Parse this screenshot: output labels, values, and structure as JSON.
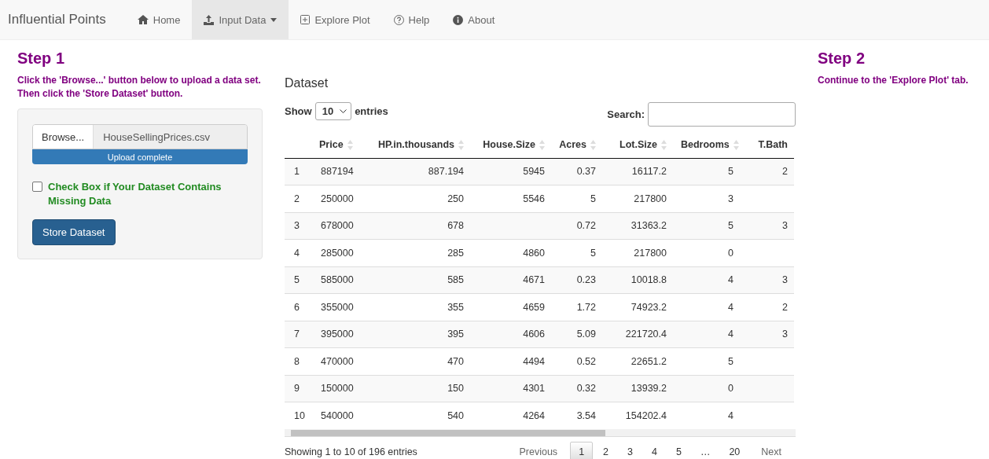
{
  "navbar": {
    "brand": "Influential Points",
    "items": [
      {
        "label": "Home",
        "selected": false,
        "dropdown": false
      },
      {
        "label": "Input Data",
        "selected": true,
        "dropdown": true
      },
      {
        "label": "Explore Plot",
        "selected": false,
        "dropdown": false
      },
      {
        "label": "Help",
        "selected": false,
        "dropdown": false
      },
      {
        "label": "About",
        "selected": false,
        "dropdown": false
      }
    ]
  },
  "step1": {
    "title": "Step 1",
    "instructions": "Click the 'Browse...' button below to upload a data set. Then click the 'Store Dataset' button.",
    "file_input": {
      "button": "Browse...",
      "value": "HouseSellingPrices.csv"
    },
    "progress": {
      "label": "Upload complete",
      "level": 1
    },
    "checkbox": {
      "label": "Check Box if Your Dataset Contains Missing Data",
      "checked": false
    },
    "store_button": "Store Dataset"
  },
  "dataset": {
    "title": "Dataset",
    "length_label_before": "Show",
    "length_value": "10",
    "length_label_after": "entries",
    "search_label": "Search:",
    "columns": [
      {
        "label": "Price",
        "sortable": true
      },
      {
        "label": "HP.in.thousands",
        "sortable": true
      },
      {
        "label": "House.Size",
        "sortable": true
      },
      {
        "label": "Acres",
        "sortable": true
      },
      {
        "label": "Lot.Size",
        "sortable": true
      },
      {
        "label": "Bedrooms",
        "sortable": true
      },
      {
        "label": "T.Bath",
        "sortable": false
      }
    ],
    "rows": [
      {
        "index": "1",
        "cells": [
          "887194",
          "887.194",
          "5945",
          "0.37",
          "16117.2",
          "5",
          "2"
        ]
      },
      {
        "index": "2",
        "cells": [
          "250000",
          "250",
          "5546",
          "5",
          "217800",
          "3",
          ""
        ]
      },
      {
        "index": "3",
        "cells": [
          "678000",
          "678",
          "",
          "0.72",
          "31363.2",
          "5",
          "3"
        ]
      },
      {
        "index": "4",
        "cells": [
          "285000",
          "285",
          "4860",
          "5",
          "217800",
          "0",
          ""
        ]
      },
      {
        "index": "5",
        "cells": [
          "585000",
          "585",
          "4671",
          "0.23",
          "10018.8",
          "4",
          "3"
        ]
      },
      {
        "index": "6",
        "cells": [
          "355000",
          "355",
          "4659",
          "1.72",
          "74923.2",
          "4",
          "2"
        ]
      },
      {
        "index": "7",
        "cells": [
          "395000",
          "395",
          "4606",
          "5.09",
          "221720.4",
          "4",
          "3"
        ]
      },
      {
        "index": "8",
        "cells": [
          "470000",
          "470",
          "4494",
          "0.52",
          "22651.2",
          "5",
          ""
        ]
      },
      {
        "index": "9",
        "cells": [
          "150000",
          "150",
          "4301",
          "0.32",
          "13939.2",
          "0",
          ""
        ]
      },
      {
        "index": "10",
        "cells": [
          "540000",
          "540",
          "4264",
          "3.54",
          "154202.4",
          "4",
          ""
        ]
      }
    ],
    "info": "Showing 1 to 10 of 196 entries",
    "pagination": [
      {
        "label": "Previous",
        "kind": "nav",
        "selected": false
      },
      {
        "label": "1",
        "kind": "page",
        "selected": true
      },
      {
        "label": "2",
        "kind": "page",
        "selected": false
      },
      {
        "label": "3",
        "kind": "page",
        "selected": false
      },
      {
        "label": "4",
        "kind": "page",
        "selected": false
      },
      {
        "label": "5",
        "kind": "page",
        "selected": false
      },
      {
        "label": "…",
        "kind": "ellipsis",
        "selected": false
      },
      {
        "label": "20",
        "kind": "page",
        "selected": false
      },
      {
        "label": "Next",
        "kind": "nav",
        "selected": false
      }
    ]
  },
  "step2": {
    "title": "Step 2",
    "instructions": "Continue to the 'Explore Plot' tab."
  }
}
